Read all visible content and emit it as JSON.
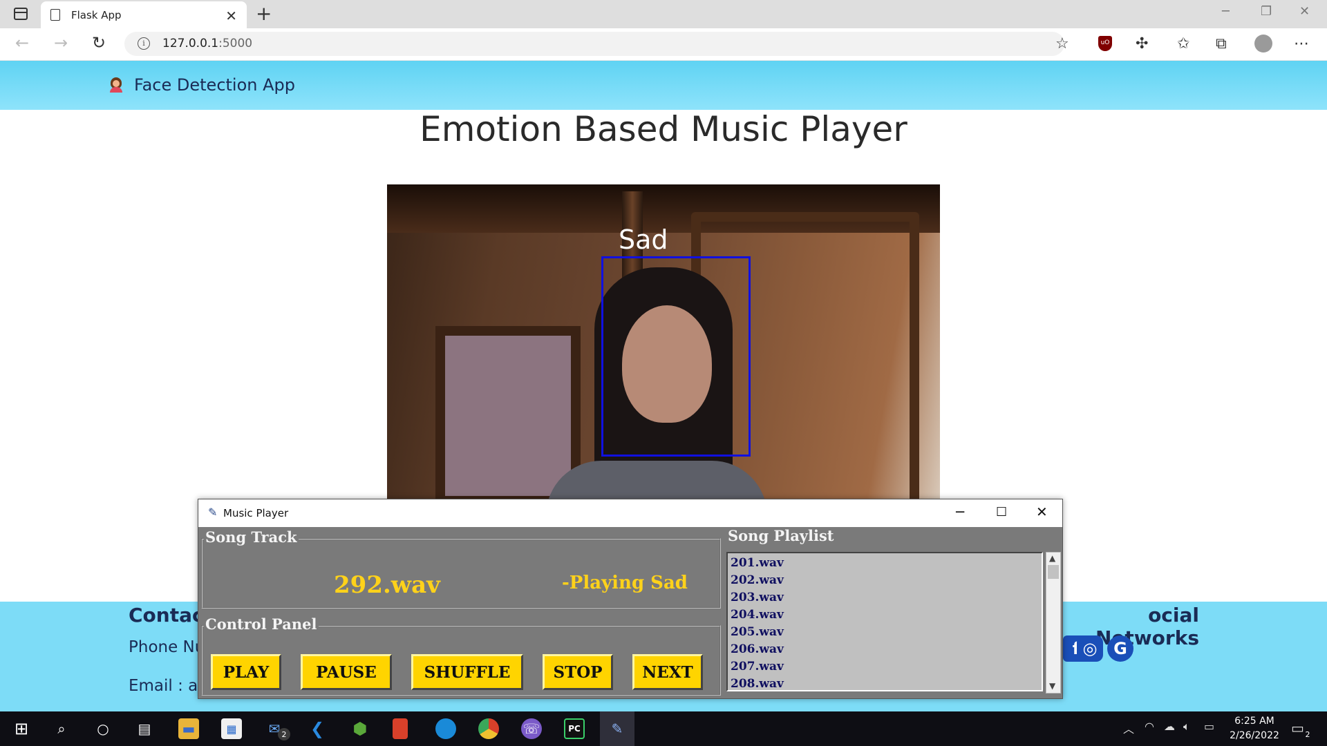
{
  "browser": {
    "tab_title": "Flask App",
    "url_host": "127.0.0.1",
    "url_port": ":5000",
    "tab_close_glyph": "✕",
    "new_tab_glyph": "+",
    "icons": [
      "sidebar-icon",
      "page-icon",
      "back-icon",
      "forward-icon",
      "refresh-icon",
      "info-icon",
      "add-favorite-icon",
      "ublock-icon",
      "extensions-icon",
      "favorites-icon",
      "collections-icon",
      "profile-icon",
      "more-icon"
    ]
  },
  "page": {
    "brand": "Face Detection App",
    "heading": "Emotion Based Music Player",
    "detected_emotion": "Sad",
    "footer": {
      "contact_title": "Contact",
      "phone_text": "Phone Nu",
      "email_text": "Email : as",
      "social_title": "ocial Networks",
      "social_icons": [
        "facebook-icon",
        "instagram-icon",
        "google-icon"
      ]
    }
  },
  "music_player": {
    "window_title": "Music Player",
    "song_track_label": "Song Track",
    "current_track": "292.wav",
    "status": "-Playing Sad",
    "control_panel_label": "Control Panel",
    "buttons": [
      "PLAY",
      "PAUSE",
      "SHUFFLE",
      "STOP",
      "NEXT"
    ],
    "playlist_label": "Song Playlist",
    "playlist": [
      "201.wav",
      "202.wav",
      "203.wav",
      "204.wav",
      "205.wav",
      "206.wav",
      "207.wav",
      "208.wav"
    ]
  },
  "taskbar": {
    "time": "6:25 AM",
    "date": "2/26/2022",
    "mail_badge": "2",
    "notification_badge": "2",
    "apps": [
      "start-icon",
      "search-icon",
      "cortana-icon",
      "task-view-icon",
      "file-explorer-icon",
      "store-icon",
      "mail-icon",
      "vscode-icon",
      "nodejs-icon",
      "office-icon",
      "edge-icon",
      "chrome-icon",
      "viber-icon",
      "pycharm-icon",
      "python-tk-icon"
    ]
  }
}
